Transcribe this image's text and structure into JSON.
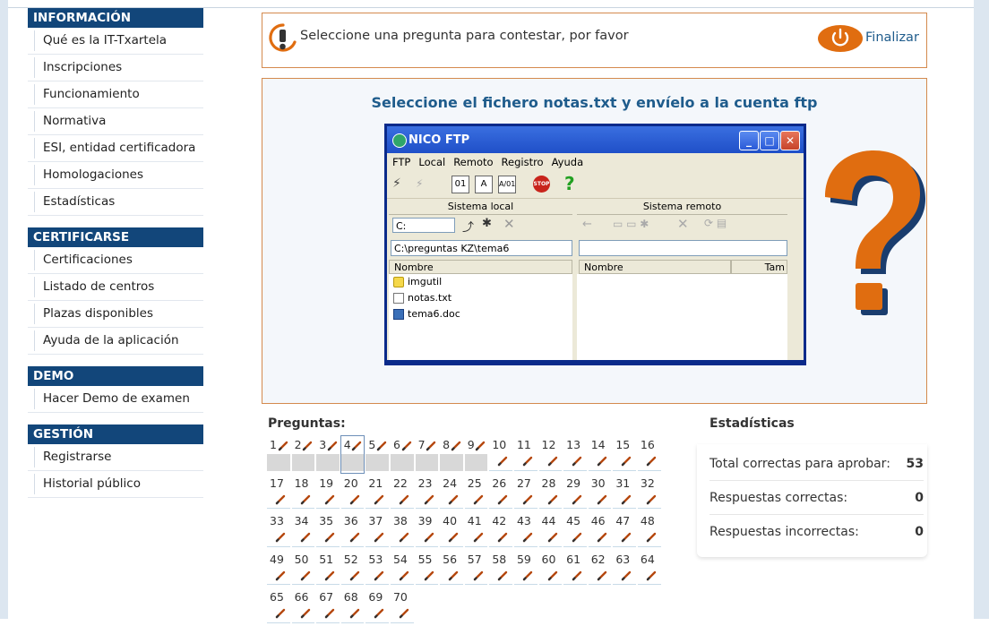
{
  "sidebar": {
    "sections": [
      {
        "title": "INFORMACIÓN",
        "items": [
          "Qué es la IT-Txartela",
          "Inscripciones",
          "Funcionamiento",
          "Normativa",
          "ESI, entidad certificadora",
          "Homologaciones",
          "Estadísticas"
        ]
      },
      {
        "title": "CERTIFICARSE",
        "items": [
          "Certificaciones",
          "Listado de centros",
          "Plazas disponibles",
          "Ayuda de la aplicación"
        ]
      },
      {
        "title": "DEMO",
        "items": [
          "Hacer Demo de examen"
        ]
      },
      {
        "title": "GESTIÓN",
        "items": [
          "Registrarse",
          "Historial público"
        ]
      }
    ]
  },
  "message": {
    "text": "Seleccione una pregunta para contestar, por favor",
    "finalize_label": "Finalizar",
    "icon": "warning-icon"
  },
  "question": {
    "title": "Seleccione el fichero notas.txt y envíelo a la cuenta ftp",
    "ftp": {
      "window_title": "NICO FTP",
      "menu": [
        "FTP",
        "Local",
        "Remoto",
        "Registro",
        "Ayuda"
      ],
      "local_pane": "Sistema local",
      "remote_pane": "Sistema remoto",
      "drive": "C:",
      "local_path": "C:\\preguntas KZ\\tema6",
      "local_col_name": "Nombre",
      "remote_col_name": "Nombre",
      "remote_col_size": "Tam",
      "files": [
        {
          "name": "imgutil",
          "type": "folder"
        },
        {
          "name": "notas.txt",
          "type": "text"
        },
        {
          "name": "tema6.doc",
          "type": "doc"
        }
      ],
      "tool_labels": [
        "01",
        "A",
        "A/01",
        "STOP"
      ]
    }
  },
  "questions": {
    "label": "Preguntas:",
    "total": 70,
    "answered": [
      1,
      2,
      3,
      4,
      5,
      6,
      7,
      8,
      9
    ],
    "current": 4
  },
  "stats": {
    "title": "Estadísticas",
    "rows": [
      {
        "label": "Total correctas para aprobar:",
        "value": "53"
      },
      {
        "label": "Respuestas correctas:",
        "value": "0"
      },
      {
        "label": "Respuestas incorrectas:",
        "value": "0"
      }
    ]
  },
  "colors": {
    "header_blue": "#12467a",
    "accent_orange": "#e06d10",
    "link_blue": "#1f5c8c",
    "box_border": "#d48a4e"
  }
}
